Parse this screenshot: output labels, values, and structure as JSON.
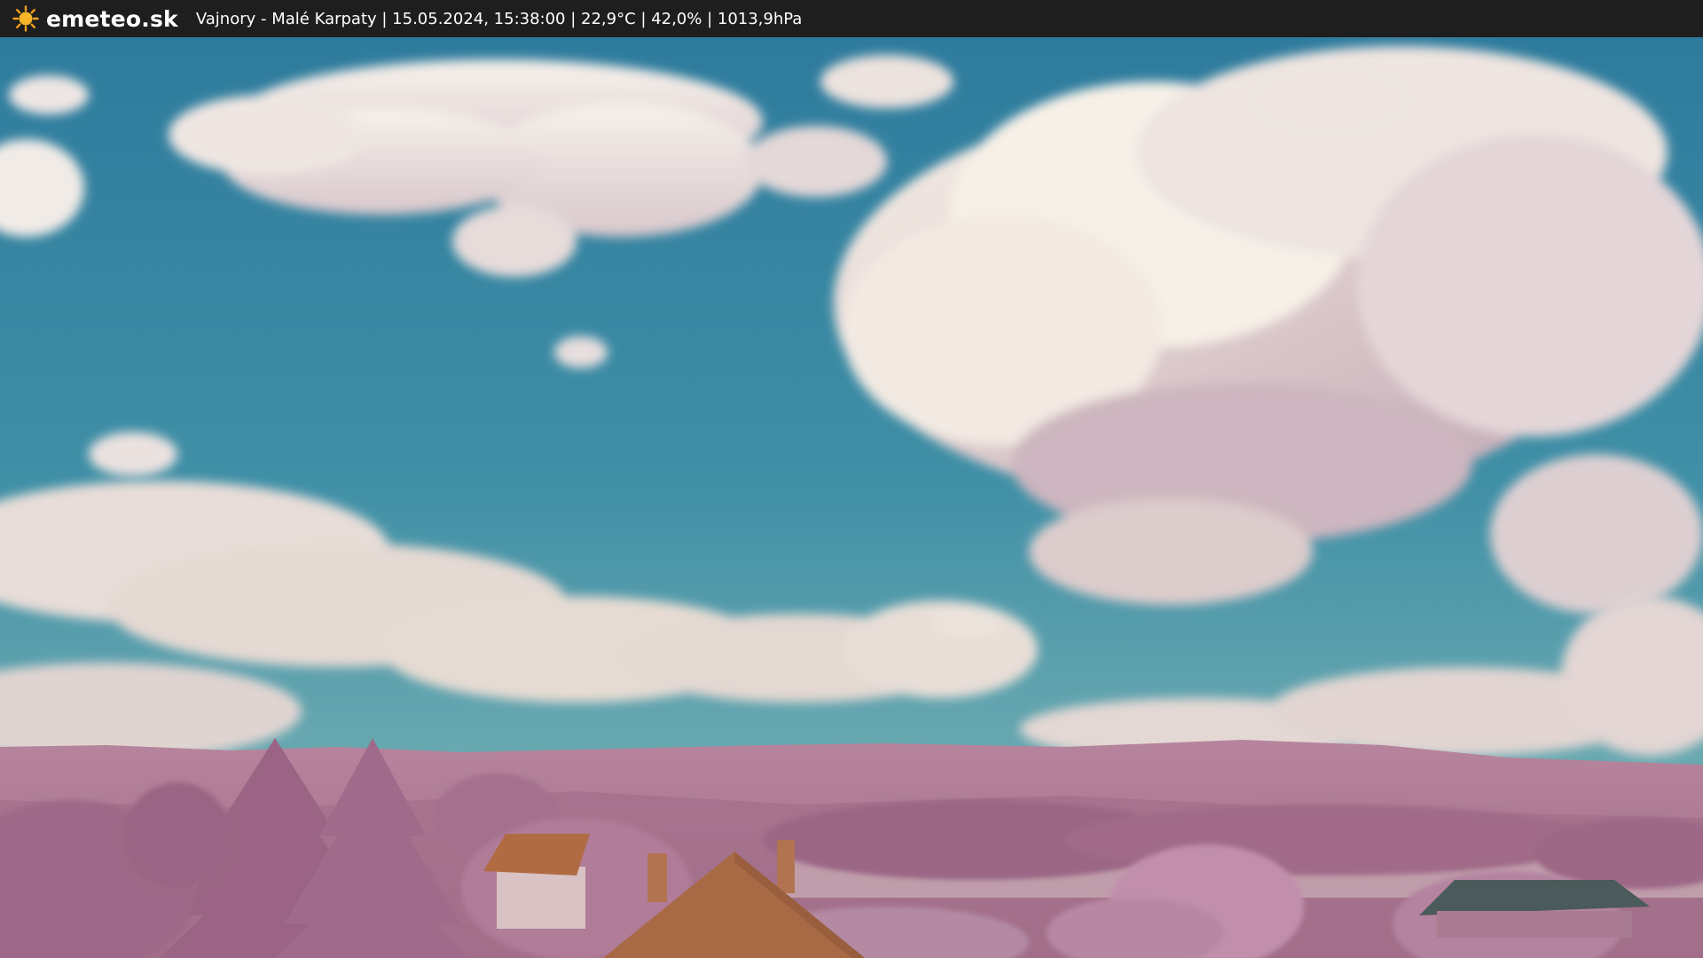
{
  "header": {
    "brand": "emeteo.sk",
    "caption": "Vajnory - Malé Karpaty | 15.05.2024, 15:38:00 | 22,9°C | 42,0% | 1013,9hPa",
    "logo_icon": "sun-icon"
  },
  "colors": {
    "bar_background": "#1e1e1e",
    "sky_top": "#2f7fa0",
    "sky_bottom": "#5aa5b0",
    "cloud": "#efe6e6",
    "hills": "#b07a95",
    "trees": "#a5708e",
    "roof": "#a86a45"
  }
}
